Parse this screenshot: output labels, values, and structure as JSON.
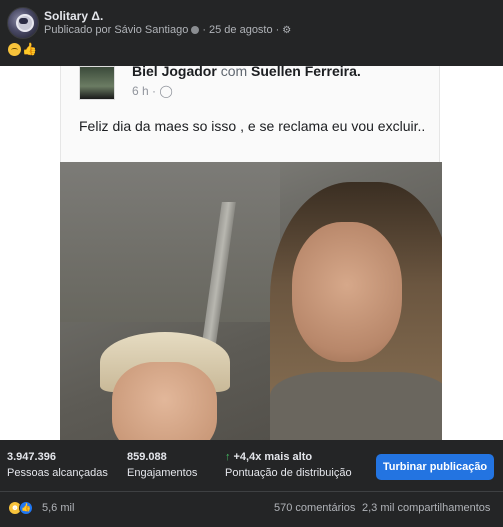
{
  "post": {
    "page_name": "Solitary Δ.",
    "published_by": "Publicado por Sávio Santiago",
    "separator": "·",
    "date": "25 de agosto",
    "caption_emojis": [
      "sad-face-icon",
      "thumbs-up-icon"
    ]
  },
  "embedded_post": {
    "author": "Biel Jogador",
    "with_word": "com",
    "tagged": "Suellen Ferreira.",
    "time": "6 h ·",
    "text": "Feliz dia da maes so isso , e se reclama eu vou excluir.."
  },
  "stats": {
    "reach": {
      "value": "3.947.396",
      "label": "Pessoas alcançadas"
    },
    "engagement": {
      "value": "859.088",
      "label": "Engajamentos"
    },
    "distribution": {
      "value": "+4,4x mais alto",
      "label": "Pontuação de distribuição"
    },
    "boost_label": "Turbinar publicação"
  },
  "footer": {
    "reactions_count": "5,6 mil",
    "comments": "570 comentários",
    "shares": "2,3 mil compartilhamentos"
  },
  "colors": {
    "background": "#242526",
    "accent": "#2374e1",
    "positive": "#45bd62"
  }
}
